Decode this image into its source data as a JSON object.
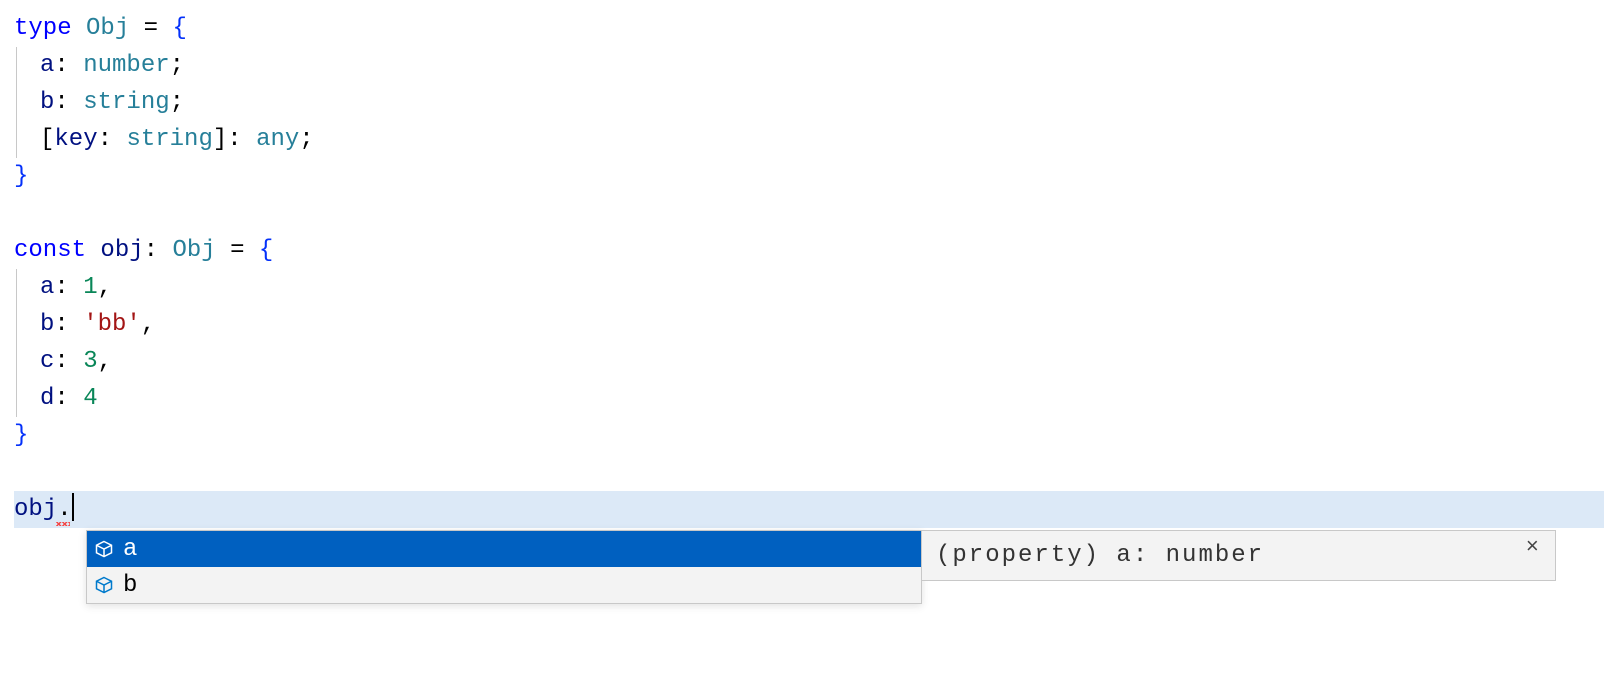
{
  "colors": {
    "keyword": "#0000ff",
    "type": "#267f99",
    "identifier": "#001080",
    "number": "#098658",
    "string": "#a31515",
    "brace": "#0431fa",
    "selectionBg": "#0060c0",
    "lineHighlight": "#dce9f7",
    "iconField": "#007acc"
  },
  "code": {
    "lines": [
      {
        "tokens": [
          {
            "t": "type ",
            "c": "kw"
          },
          {
            "t": "Obj",
            "c": "type"
          },
          {
            "t": " = ",
            "c": "eq"
          },
          {
            "t": "{",
            "c": "brace"
          }
        ]
      },
      {
        "indent": true,
        "tokens": [
          {
            "t": "a",
            "c": "prop"
          },
          {
            "t": ": ",
            "c": "colon"
          },
          {
            "t": "number",
            "c": "type"
          },
          {
            "t": ";",
            "c": "semi"
          }
        ]
      },
      {
        "indent": true,
        "tokens": [
          {
            "t": "b",
            "c": "prop"
          },
          {
            "t": ": ",
            "c": "colon"
          },
          {
            "t": "string",
            "c": "type"
          },
          {
            "t": ";",
            "c": "semi"
          }
        ]
      },
      {
        "indent": true,
        "tokens": [
          {
            "t": "[",
            "c": "bracket"
          },
          {
            "t": "key",
            "c": "prop"
          },
          {
            "t": ": ",
            "c": "colon"
          },
          {
            "t": "string",
            "c": "type"
          },
          {
            "t": "]",
            "c": "bracket"
          },
          {
            "t": ": ",
            "c": "colon"
          },
          {
            "t": "any",
            "c": "type"
          },
          {
            "t": ";",
            "c": "semi"
          }
        ]
      },
      {
        "tokens": [
          {
            "t": "}",
            "c": "brace"
          }
        ]
      },
      {
        "tokens": []
      },
      {
        "tokens": [
          {
            "t": "const ",
            "c": "kw"
          },
          {
            "t": "obj",
            "c": "ident"
          },
          {
            "t": ": ",
            "c": "colon"
          },
          {
            "t": "Obj",
            "c": "type"
          },
          {
            "t": " = ",
            "c": "eq"
          },
          {
            "t": "{",
            "c": "brace"
          }
        ]
      },
      {
        "indent": true,
        "tokens": [
          {
            "t": "a",
            "c": "prop"
          },
          {
            "t": ": ",
            "c": "colon"
          },
          {
            "t": "1",
            "c": "num"
          },
          {
            "t": ",",
            "c": "comma"
          }
        ]
      },
      {
        "indent": true,
        "tokens": [
          {
            "t": "b",
            "c": "prop"
          },
          {
            "t": ": ",
            "c": "colon"
          },
          {
            "t": "'bb'",
            "c": "str"
          },
          {
            "t": ",",
            "c": "comma"
          }
        ]
      },
      {
        "indent": true,
        "tokens": [
          {
            "t": "c",
            "c": "prop"
          },
          {
            "t": ": ",
            "c": "colon"
          },
          {
            "t": "3",
            "c": "num"
          },
          {
            "t": ",",
            "c": "comma"
          }
        ]
      },
      {
        "indent": true,
        "tokens": [
          {
            "t": "d",
            "c": "prop"
          },
          {
            "t": ": ",
            "c": "colon"
          },
          {
            "t": "4",
            "c": "num"
          }
        ]
      },
      {
        "tokens": [
          {
            "t": "}",
            "c": "brace"
          }
        ]
      },
      {
        "tokens": []
      }
    ],
    "activeLine": {
      "prefix": "obj",
      "trigger": ".",
      "squiggle": true
    }
  },
  "suggest": {
    "items": [
      {
        "label": "a",
        "selected": true,
        "icon": "field-icon"
      },
      {
        "label": "b",
        "selected": false,
        "icon": "field-icon"
      }
    ],
    "detail": "(property) a: number",
    "close": "×"
  }
}
